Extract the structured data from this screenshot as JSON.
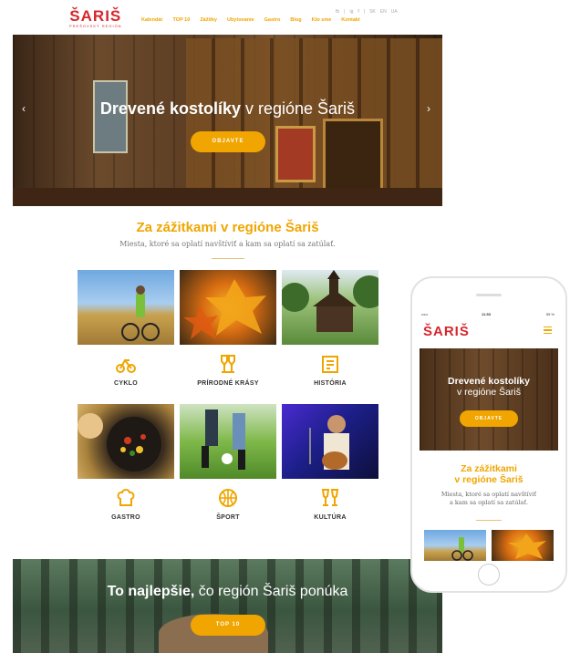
{
  "brand": {
    "name": "ŠARIŠ",
    "tagline": "PREŠOVSKÝ REGIÓN",
    "red": "#d6272d",
    "accent": "#f0a500"
  },
  "nav": [
    "Kalendár",
    "TOP 10",
    "Zážitky",
    "Ubytovanie",
    "Gastro",
    "Blog",
    "Kto sme",
    "Kontakt"
  ],
  "social": [
    "fb",
    "|",
    "ig",
    "f",
    "|",
    "SK",
    "EN",
    "UA"
  ],
  "hero": {
    "title_bold": "Drevené kostolíky",
    "title_rest": " v regióne Šariš",
    "cta": "OBJAVTE",
    "prev_icon": "chevron-left-icon",
    "next_icon": "chevron-right-icon"
  },
  "experiences": {
    "title": "Za zážitkami v regióne Šariš",
    "subtitle": "Miesta, ktoré sa oplatí navštíviť a kam sa oplatí sa zatúlať.",
    "categories": [
      {
        "label": "CYKLO",
        "icon": "bicycle-icon",
        "glyph": "ᔕ"
      },
      {
        "label": "PRÍRODNÉ KRÁSY",
        "icon": "nature-icon",
        "glyph": "⚘"
      },
      {
        "label": "HISTÓRIA",
        "icon": "history-icon",
        "glyph": "♖"
      },
      {
        "label": "GASTRO",
        "icon": "chef-hat-icon",
        "glyph": "♨"
      },
      {
        "label": "ŠPORT",
        "icon": "basketball-icon",
        "glyph": "⊕"
      },
      {
        "label": "KULTÚRA",
        "icon": "glasses-icon",
        "glyph": "♕"
      }
    ]
  },
  "best": {
    "title_bold": "To najlepšie,",
    "title_rest": " čo región Šariš ponúka",
    "cta": "TOP 10"
  },
  "mobile": {
    "status_left": "•••••",
    "status_time": "11:53",
    "status_right": "55 %",
    "hero_bold": "Drevené kostolíky",
    "hero_rest": "v regióne Šariš",
    "cta": "OBJAVTE",
    "sec_title_1": "Za zážitkami",
    "sec_title_2": "v regióne Šariš",
    "sec_sub_1": "Miesta, ktoré sa oplatí navštíviť",
    "sec_sub_2": "a kam sa oplatí sa zatúlať."
  }
}
